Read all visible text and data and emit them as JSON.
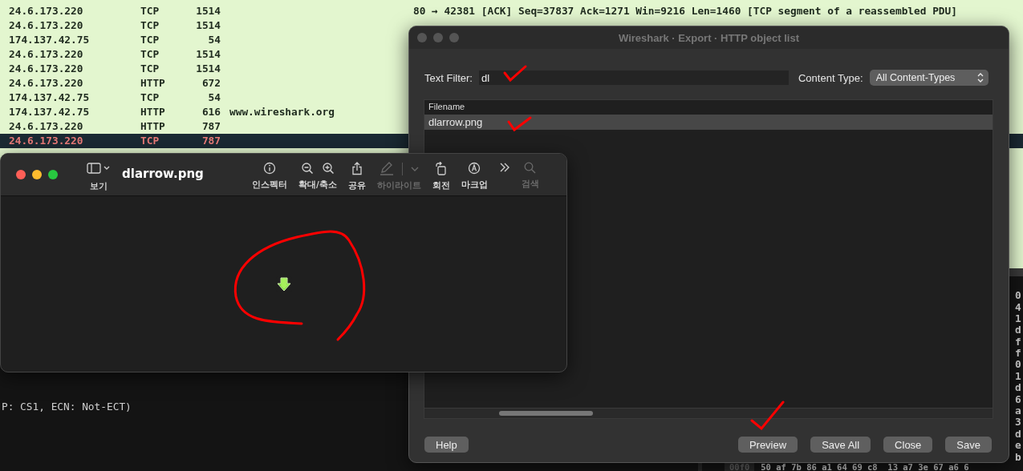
{
  "packet_list": {
    "rows": [
      {
        "source": "24.6.173.220",
        "protocol": "TCP",
        "length": "1514",
        "host": "",
        "info": "80 → 42381 [ACK] Seq=37837 Ack=1271 Win=9216 Len=1460 [TCP segment of a reassembled PDU]",
        "selected": false
      },
      {
        "source": "24.6.173.220",
        "protocol": "TCP",
        "length": "1514",
        "host": "",
        "info": "",
        "selected": false
      },
      {
        "source": "174.137.42.75",
        "protocol": "TCP",
        "length": "54",
        "host": "",
        "info": "",
        "selected": false
      },
      {
        "source": "24.6.173.220",
        "protocol": "TCP",
        "length": "1514",
        "host": "",
        "info": "",
        "selected": false
      },
      {
        "source": "24.6.173.220",
        "protocol": "TCP",
        "length": "1514",
        "host": "",
        "info": "",
        "selected": false
      },
      {
        "source": "24.6.173.220",
        "protocol": "HTTP",
        "length": "672",
        "host": "",
        "info": "",
        "selected": false
      },
      {
        "source": "174.137.42.75",
        "protocol": "TCP",
        "length": "54",
        "host": "",
        "info": "",
        "selected": false
      },
      {
        "source": "174.137.42.75",
        "protocol": "HTTP",
        "length": "616",
        "host": "www.wireshark.org",
        "info": "",
        "selected": false
      },
      {
        "source": "24.6.173.220",
        "protocol": "HTTP",
        "length": "787",
        "host": "",
        "info": "",
        "selected": false
      },
      {
        "source": "24.6.173.220",
        "protocol": "TCP",
        "length": "787",
        "host": "",
        "info": "",
        "selected": true
      }
    ]
  },
  "packet_details": {
    "lines": [
      "P: CS1, ECN: Not-ECT)"
    ]
  },
  "packet_bytes": {
    "lines": [
      "0",
      "4",
      "1",
      "d",
      "f",
      "f",
      "0",
      "1",
      "d",
      "6",
      "a",
      "3",
      "d",
      "e",
      "b"
    ],
    "last_line": {
      "offset": "00f0",
      "bytes": "50 af 7b 86 a1 64 69 c8  13 a7 3e 67 a6 6"
    }
  },
  "preview_window": {
    "title": "dlarrow.png",
    "toolbar": [
      {
        "kind": "sidebar",
        "label": "보기",
        "disabled": false
      },
      {
        "kind": "inspector",
        "label": "인스펙터",
        "disabled": false
      },
      {
        "kind": "zoom",
        "label": "확대/축소",
        "disabled": false
      },
      {
        "kind": "share",
        "label": "공유",
        "disabled": false
      },
      {
        "kind": "highlight",
        "label": "하이라이트",
        "disabled": true
      },
      {
        "kind": "rotate",
        "label": "회전",
        "disabled": false
      },
      {
        "kind": "markup",
        "label": "마크업",
        "disabled": false
      },
      {
        "kind": "more",
        "disabled": false
      },
      {
        "kind": "search",
        "label": "검색",
        "disabled": true
      }
    ]
  },
  "export_dialog": {
    "title": "Wireshark · Export · HTTP object list",
    "text_filter": {
      "label": "Text Filter:",
      "value": "dl"
    },
    "content_type": {
      "label": "Content Type:",
      "value": "All Content-Types"
    },
    "table": {
      "columns": [
        "Filename"
      ],
      "rows": [
        {
          "filename": "dlarrow.png",
          "selected": true
        }
      ]
    },
    "buttons": [
      {
        "label": "Help",
        "kind": "left"
      },
      {
        "label": "Preview",
        "kind": "right"
      },
      {
        "label": "Save All",
        "kind": "right"
      },
      {
        "label": "Close",
        "kind": "right"
      },
      {
        "label": "Save",
        "kind": "right"
      }
    ]
  }
}
